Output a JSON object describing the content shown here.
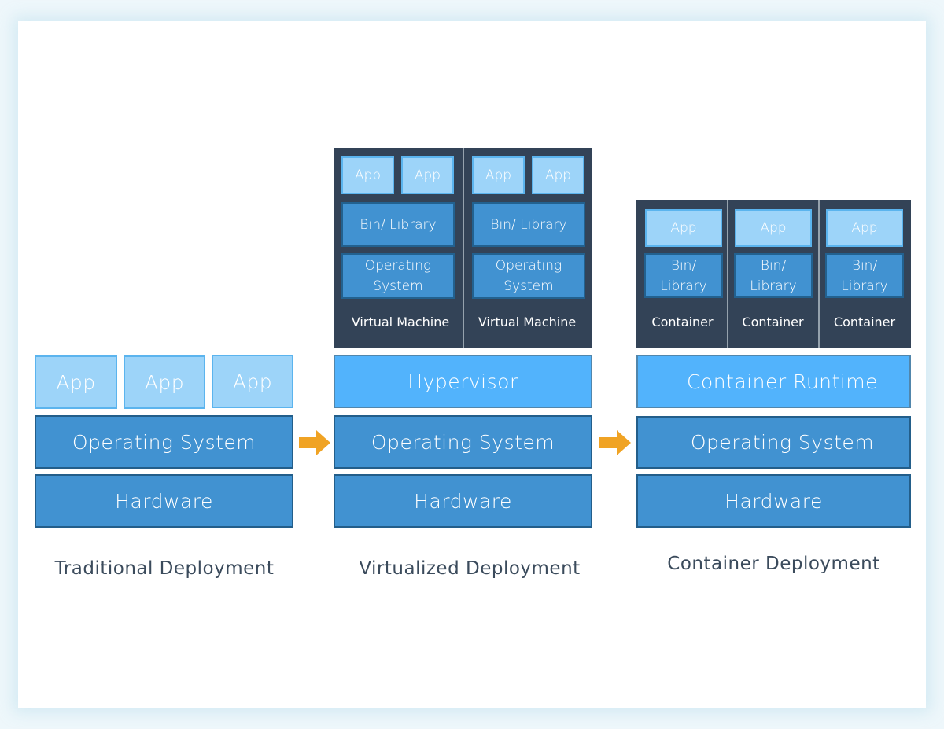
{
  "colors": {
    "app": "#9dd4f9",
    "layer": "#4192d1",
    "hypervisor": "#52b3fc",
    "machine_bg": "#334357",
    "arrow": "#f0a324",
    "caption": "#3b4b5c"
  },
  "traditional": {
    "apps": [
      "App",
      "App",
      "App"
    ],
    "os": "Operating System",
    "hardware": "Hardware",
    "caption": "Traditional Deployment"
  },
  "virtualized": {
    "vms": [
      {
        "apps": [
          "App",
          "App"
        ],
        "bin": "Bin/ Library",
        "os": "Operating System",
        "label": "Virtual Machine"
      },
      {
        "apps": [
          "App",
          "App"
        ],
        "bin": "Bin/ Library",
        "os": "Operating System",
        "label": "Virtual Machine"
      }
    ],
    "hypervisor": "Hypervisor",
    "os": "Operating System",
    "hardware": "Hardware",
    "caption": "Virtualized Deployment"
  },
  "container": {
    "containers": [
      {
        "app": "App",
        "bin": "Bin/ Library",
        "label": "Container"
      },
      {
        "app": "App",
        "bin": "Bin/ Library",
        "label": "Container"
      },
      {
        "app": "App",
        "bin": "Bin/ Library",
        "label": "Container"
      }
    ],
    "runtime": "Container Runtime",
    "os": "Operating System",
    "hardware": "Hardware",
    "caption": "Container Deployment"
  },
  "arrows": [
    "arrow-right-icon",
    "arrow-right-icon"
  ]
}
